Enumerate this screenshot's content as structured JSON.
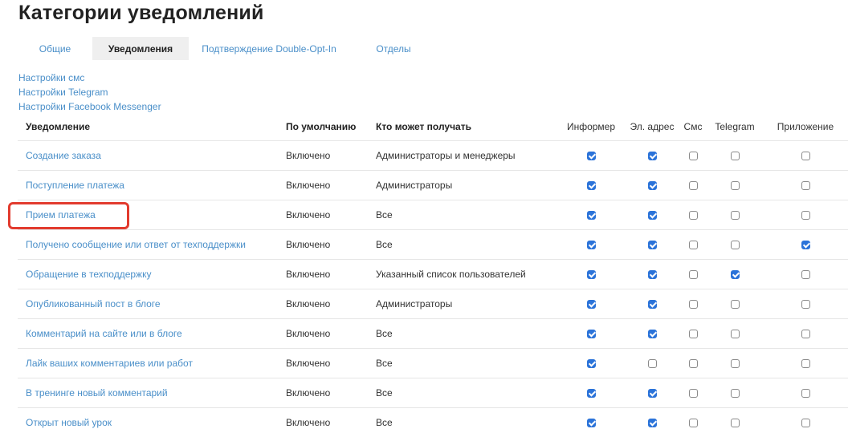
{
  "page": {
    "title": "Категории уведомлений"
  },
  "tabs": [
    {
      "label": "Общие",
      "active": false
    },
    {
      "label": "Уведомления",
      "active": true
    },
    {
      "label": "Подтверждение Double-Opt-In",
      "active": false
    },
    {
      "label": "Отделы",
      "active": false
    }
  ],
  "settings_links": [
    "Настройки смс",
    "Настройки Telegram",
    "Настройки Facebook Messenger"
  ],
  "table": {
    "columns": {
      "notification": "Уведомление",
      "default": "По умолчанию",
      "recipients": "Кто может получать",
      "informer": "Информер",
      "email": "Эл. адрес",
      "sms": "Смс",
      "telegram": "Telegram",
      "app": "Приложение"
    },
    "rows": [
      {
        "name": "Создание заказа",
        "default": "Включено",
        "recipients": "Администраторы и менеджеры",
        "checks": [
          true,
          true,
          false,
          false,
          false
        ]
      },
      {
        "name": "Поступление платежа",
        "default": "Включено",
        "recipients": "Администраторы",
        "checks": [
          true,
          true,
          false,
          false,
          false
        ]
      },
      {
        "name": "Прием платежа",
        "default": "Включено",
        "recipients": "Все",
        "checks": [
          true,
          true,
          false,
          false,
          false
        ]
      },
      {
        "name": "Получено сообщение или ответ от техподдержки",
        "default": "Включено",
        "recipients": "Все",
        "checks": [
          true,
          true,
          false,
          false,
          true
        ]
      },
      {
        "name": "Обращение в техподдержку",
        "default": "Включено",
        "recipients": "Указанный список пользователей",
        "checks": [
          true,
          true,
          false,
          true,
          false
        ]
      },
      {
        "name": "Опубликованный пост в блоге",
        "default": "Включено",
        "recipients": "Администраторы",
        "checks": [
          true,
          true,
          false,
          false,
          false
        ]
      },
      {
        "name": "Комментарий на сайте или в блоге",
        "default": "Включено",
        "recipients": "Все",
        "checks": [
          true,
          true,
          false,
          false,
          false
        ]
      },
      {
        "name": "Лайк ваших комментариев или работ",
        "default": "Включено",
        "recipients": "Все",
        "checks": [
          true,
          false,
          false,
          false,
          false
        ]
      },
      {
        "name": "В тренинге новый комментарий",
        "default": "Включено",
        "recipients": "Все",
        "checks": [
          true,
          true,
          false,
          false,
          false
        ]
      },
      {
        "name": "Открыт новый урок",
        "default": "Включено",
        "recipients": "Все",
        "checks": [
          true,
          true,
          false,
          false,
          false
        ]
      }
    ]
  },
  "colors": {
    "link": "#4a8fc9",
    "checkbox_checked": "#2b73d9",
    "highlight": "#e23b2e",
    "active_tab_bg": "#efefef"
  }
}
